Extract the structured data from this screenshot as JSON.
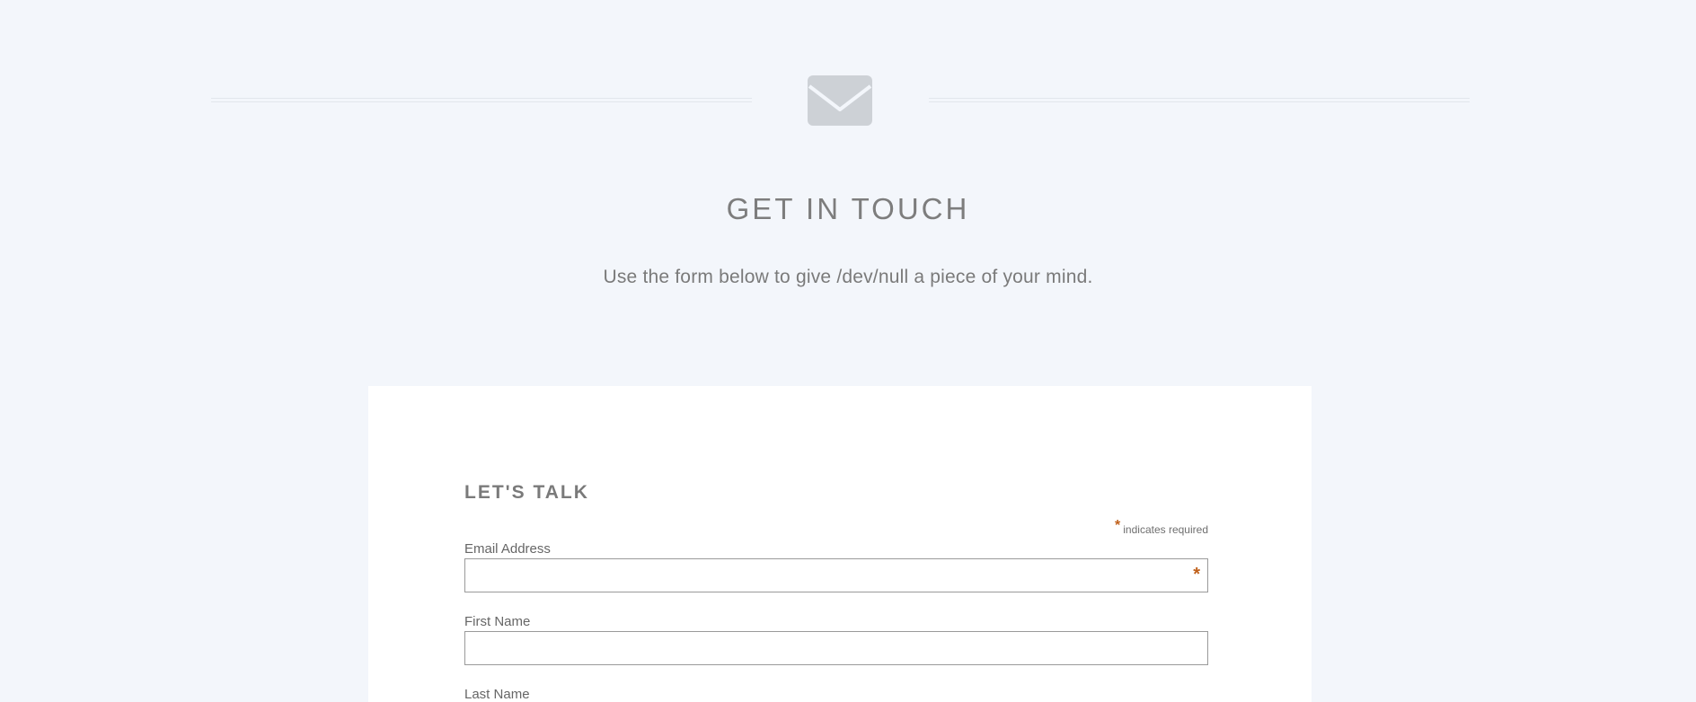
{
  "header": {
    "icon": "envelope-icon",
    "title": "GET IN TOUCH",
    "subtitle": "Use the form below to give /dev/null a piece of your mind."
  },
  "form": {
    "title": "LET'S TALK",
    "required_marker": "*",
    "required_note": "indicates required",
    "fields": [
      {
        "label": "Email Address",
        "value": "",
        "required": true
      },
      {
        "label": "First Name",
        "value": "",
        "required": false
      },
      {
        "label": "Last Name",
        "value": "",
        "required": false
      }
    ]
  },
  "colors": {
    "background": "#f3f6fb",
    "card": "#ffffff",
    "accent_required": "#c0601a",
    "icon": "#cdd1d6"
  }
}
